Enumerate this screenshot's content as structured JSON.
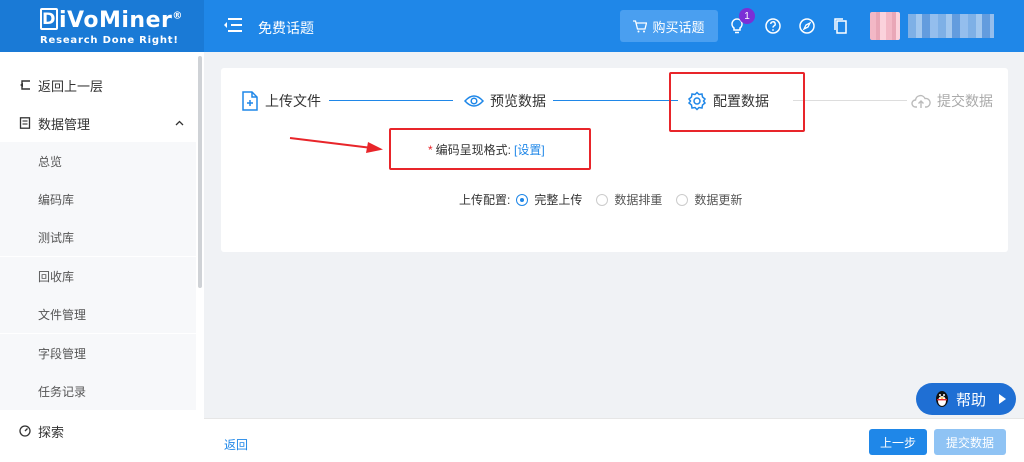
{
  "header": {
    "logo_text": "iVoMiner",
    "logo_letter": "D",
    "logo_registered": "®",
    "logo_tagline": "Research Done Right!",
    "title": "免费话题",
    "buy_button": "购买话题",
    "notification_count": "1",
    "accent": "#1f87e8"
  },
  "sidebar": {
    "back": "返回上一层",
    "data_management": "数据管理",
    "sub_items": [
      "总览",
      "编码库",
      "测试库",
      "回收库",
      "文件管理",
      "字段管理",
      "任务记录"
    ],
    "explore": "探索"
  },
  "steps": [
    {
      "label": "上传文件",
      "icon": "file-plus-icon",
      "state": "done"
    },
    {
      "label": "预览数据",
      "icon": "eye-icon",
      "state": "done"
    },
    {
      "label": "配置数据",
      "icon": "gear-icon",
      "state": "active"
    },
    {
      "label": "提交数据",
      "icon": "cloud-upload-icon",
      "state": "pending"
    }
  ],
  "form": {
    "required_mark": "*",
    "encoding_label": "编码呈现格式:",
    "encoding_link": "[设置]",
    "upload_config_label": "上传配置:",
    "options": [
      {
        "label": "完整上传",
        "checked": true
      },
      {
        "label": "数据排重",
        "checked": false
      },
      {
        "label": "数据更新",
        "checked": false
      }
    ]
  },
  "help": {
    "label": "帮助"
  },
  "footer": {
    "back": "返回",
    "prev": "上一步",
    "submit": "提交数据"
  }
}
